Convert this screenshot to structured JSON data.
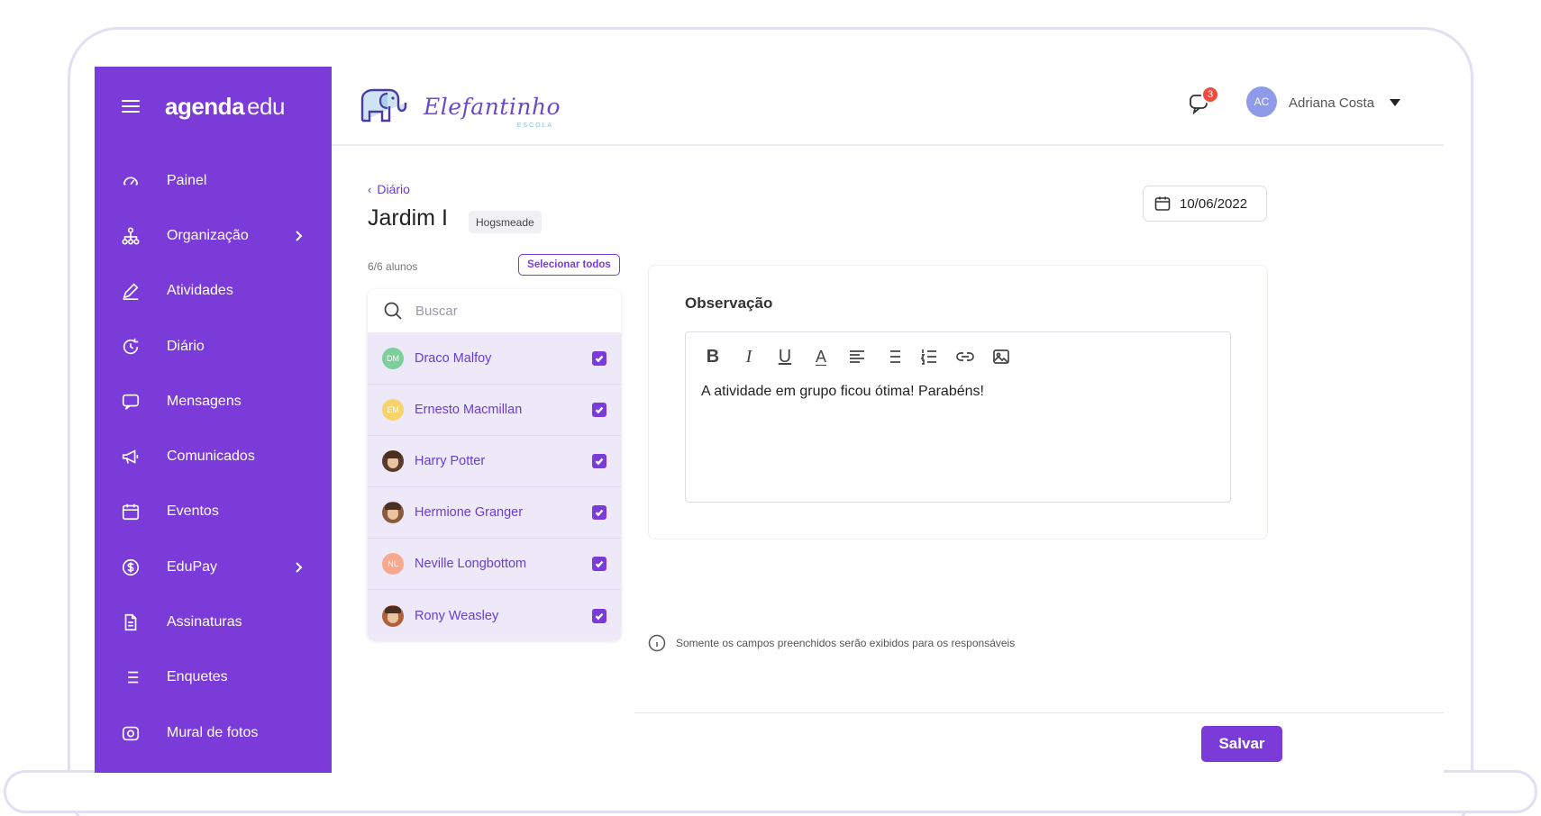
{
  "colors": {
    "brand_purple": "#7a3bd8",
    "link_purple": "#6a3dd4",
    "badge_red": "#ef4b3f",
    "row_highlight": "#ede9f8"
  },
  "sidebar": {
    "logo_bold": "agenda",
    "logo_light": "edu",
    "items": [
      {
        "label": "Painel",
        "icon": "speedometer-icon"
      },
      {
        "label": "Organização",
        "icon": "org-chart-icon",
        "has_submenu": true
      },
      {
        "label": "Atividades",
        "icon": "pencil-icon"
      },
      {
        "label": "Diário",
        "icon": "refresh-clock-icon"
      },
      {
        "label": "Mensagens",
        "icon": "message-icon"
      },
      {
        "label": "Comunicados",
        "icon": "megaphone-icon"
      },
      {
        "label": "Eventos",
        "icon": "calendar-icon"
      },
      {
        "label": "EduPay",
        "icon": "dollar-icon",
        "has_submenu": true
      },
      {
        "label": "Assinaturas",
        "icon": "document-icon"
      },
      {
        "label": "Enquetes",
        "icon": "list-icon"
      },
      {
        "label": "Mural de fotos",
        "icon": "camera-icon"
      }
    ]
  },
  "header": {
    "school_name": "Elefantinho",
    "school_sub": "ESCOLA",
    "chat_badge_count": "3",
    "user_initials": "AC",
    "user_name": "Adriana Costa"
  },
  "main": {
    "breadcrumb": "Diário",
    "title": "Jardim I",
    "class_badge": "Hogsmeade",
    "date": "10/06/2022",
    "student_count": "6/6 alunos",
    "select_all_label": "Selecionar todos",
    "search_placeholder": "Buscar",
    "students": [
      {
        "name": "Draco Malfoy",
        "initials": "DM",
        "avatar_color": "#7ccf9a",
        "photo": false,
        "checked": true
      },
      {
        "name": "Ernesto Macmillan",
        "initials": "EM",
        "avatar_color": "#f6d36b",
        "photo": false,
        "checked": true
      },
      {
        "name": "Harry Potter",
        "initials": "",
        "avatar_color": "#5a3c2c",
        "photo": true,
        "checked": true
      },
      {
        "name": "Hermione Granger",
        "initials": "",
        "avatar_color": "#8a5a3c",
        "photo": true,
        "checked": true
      },
      {
        "name": "Neville Longbottom",
        "initials": "NL",
        "avatar_color": "#f7a88f",
        "photo": false,
        "checked": true
      },
      {
        "name": "Rony Weasley",
        "initials": "",
        "avatar_color": "#b0603a",
        "photo": true,
        "checked": true
      }
    ],
    "observation_title": "Observação",
    "observation_text": "A atividade em grupo ficou ótima! Parabéns!",
    "toolbar": [
      "bold",
      "italic",
      "underline",
      "font-color",
      "align-left",
      "bullet-list",
      "numbered-list",
      "link",
      "image"
    ],
    "hint_text": "Somente os campos preenchidos serão exibidos para os responsáveis",
    "save_label": "Salvar"
  }
}
